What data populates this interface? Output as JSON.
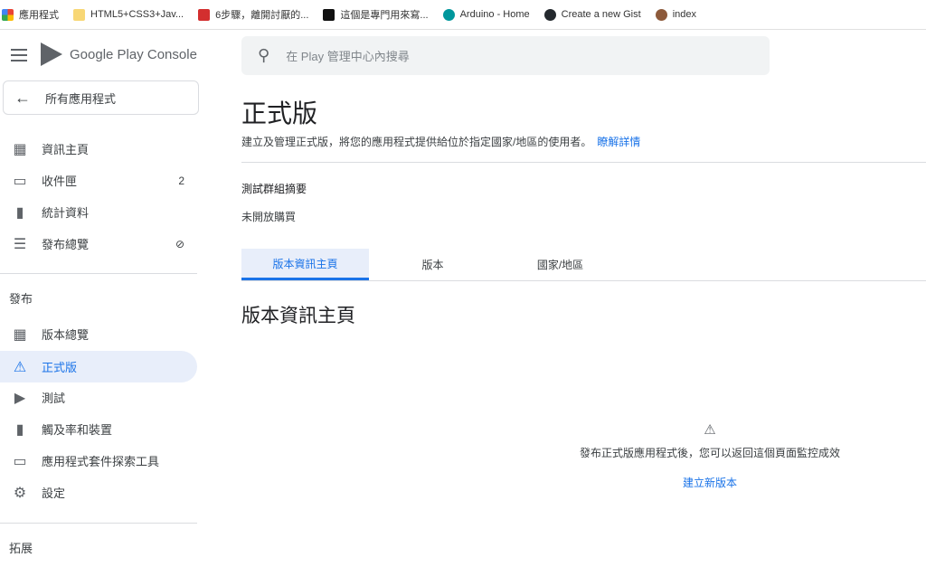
{
  "bookmarks": [
    {
      "label": "應用程式",
      "icon": "apps-grid-icon",
      "color": "#e94235"
    },
    {
      "label": "HTML5+CSS3+Jav...",
      "icon": "folder-icon",
      "color": "#f8d775"
    },
    {
      "label": "6步驟，離開討厭的...",
      "icon": "site-icon",
      "color": "#d32f2f"
    },
    {
      "label": "這個是專門用來寫...",
      "icon": "medium-icon",
      "color": "#111111"
    },
    {
      "label": "Arduino - Home",
      "icon": "arduino-icon",
      "color": "#00979c"
    },
    {
      "label": "Create a new Gist",
      "icon": "github-icon",
      "color": "#24292e"
    },
    {
      "label": "index",
      "icon": "avatar-icon",
      "color": "#8d5a3b"
    }
  ],
  "sidebar": {
    "logo": "Google Play Console",
    "back": "所有應用程式",
    "items": [
      {
        "label": "資訊主頁",
        "icon": "▦"
      },
      {
        "label": "收件匣",
        "icon": "▭",
        "badge": "2"
      },
      {
        "label": "統計資料",
        "icon": "▮"
      },
      {
        "label": "發布總覽",
        "icon": "☰"
      }
    ],
    "section1": "發布",
    "items2": [
      {
        "label": "版本總覽",
        "icon": "▦"
      },
      {
        "label": "正式版",
        "icon": "⚠"
      },
      {
        "label": "測試",
        "icon": "▶"
      },
      {
        "label": "觸及率和裝置",
        "icon": "▮"
      },
      {
        "label": "應用程式套件探索工具",
        "icon": "▭"
      },
      {
        "label": "設定",
        "icon": "⚙"
      }
    ],
    "section2": "拓展"
  },
  "search": {
    "placeholder": "在 Play 管理中心內搜尋"
  },
  "main": {
    "title": "正式版",
    "subtitle": "建立及管理正式版，將您的應用程式提供給位於指定國家/地區的使用者。",
    "learn_more": "瞭解詳情",
    "group_title": "測試群組摘要",
    "group_value": "未開放購買",
    "tabs": [
      "版本資訊主頁",
      "版本",
      "國家/地區"
    ],
    "section_title": "版本資訊主頁",
    "empty_text": "發布正式版應用程式後，您可以返回這個頁面監控成效",
    "create_link": "建立新版本"
  },
  "colors": {
    "accent": "#1a73e8",
    "active_bg": "#e8eefa"
  }
}
